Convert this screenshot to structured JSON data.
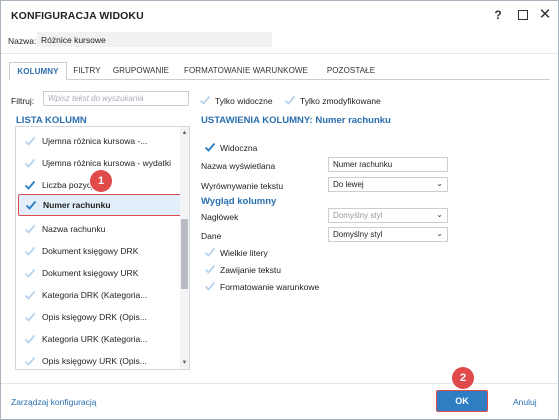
{
  "window": {
    "title": "KONFIGURACJA WIDOKU",
    "help_label": "?",
    "close_label": "✕"
  },
  "name_field": {
    "label": "Nazwa:",
    "value": "Różnice kursowe"
  },
  "tabs": [
    {
      "label": "KOLUMNY",
      "active": true
    },
    {
      "label": "FILTRY",
      "active": false
    },
    {
      "label": "GRUPOWANIE",
      "active": false
    },
    {
      "label": "FORMATOWANIE WARUNKOWE",
      "active": false
    },
    {
      "label": "POZOSTAŁE",
      "active": false
    }
  ],
  "filter": {
    "label": "Filtruj:",
    "placeholder": "Wpisz tekst do wyszukania",
    "only_visible": {
      "label": "Tylko widoczne",
      "checked": false
    },
    "only_modified": {
      "label": "Tylko zmodyfikowane",
      "checked": false
    }
  },
  "column_list": {
    "title": "LISTA KOLUMN",
    "items": [
      {
        "label": "Ujemna różnica kursowa -...",
        "checked": false,
        "selected": false
      },
      {
        "label": "Ujemna różnica kursowa - wydatki",
        "checked": false,
        "selected": false
      },
      {
        "label": "Liczba pozycji",
        "checked": true,
        "selected": false
      },
      {
        "label": "Numer rachunku",
        "checked": true,
        "selected": true
      },
      {
        "label": "Nazwa rachunku",
        "checked": false,
        "selected": false
      },
      {
        "label": "Dokument księgowy DRK",
        "checked": false,
        "selected": false
      },
      {
        "label": "Dokument księgowy URK",
        "checked": false,
        "selected": false
      },
      {
        "label": "Kategoria DRK (Kategoria...",
        "checked": false,
        "selected": false
      },
      {
        "label": "Opis księgowy DRK (Opis...",
        "checked": false,
        "selected": false
      },
      {
        "label": "Kategoria URK (Kategoria...",
        "checked": false,
        "selected": false
      },
      {
        "label": "Opis księgowy URK (Opis...",
        "checked": false,
        "selected": false
      }
    ]
  },
  "column_settings": {
    "title": "USTAWIENIA KOLUMNY: Numer rachunku",
    "visible": {
      "label": "Widoczna",
      "checked": true
    },
    "display_name": {
      "label": "Nazwa wyświetlana",
      "value": "Numer rachunku"
    },
    "text_alignment": {
      "label": "Wyrównywanie tekstu",
      "value": "Do lewej"
    },
    "appearance_title": "Wygląd kolumny",
    "header_style": {
      "label": "Nagłówek",
      "value": "Domyślny styl"
    },
    "data_style": {
      "label": "Dane",
      "value": "Domyślny styl"
    },
    "uppercase": {
      "label": "Wielkie litery",
      "checked": false
    },
    "text_wrap": {
      "label": "Zawijanie tekstu",
      "checked": false
    },
    "conditional_format": {
      "label": "Formatowanie warunkowe",
      "checked": false
    }
  },
  "annotations": {
    "badge1": "1",
    "badge2": "2"
  },
  "footer": {
    "manage_link": "Zarządzaj konfiguracją",
    "ok_label": "OK",
    "cancel_label": "Anuluj"
  },
  "colors": {
    "accent": "#2a6fb0",
    "ok_button": "#2f7dc3",
    "highlight_border": "#e04a4a",
    "selected_row_bg": "#e2eef9",
    "check_on": "#2a7fc4",
    "check_off": "#b9d4ec"
  }
}
